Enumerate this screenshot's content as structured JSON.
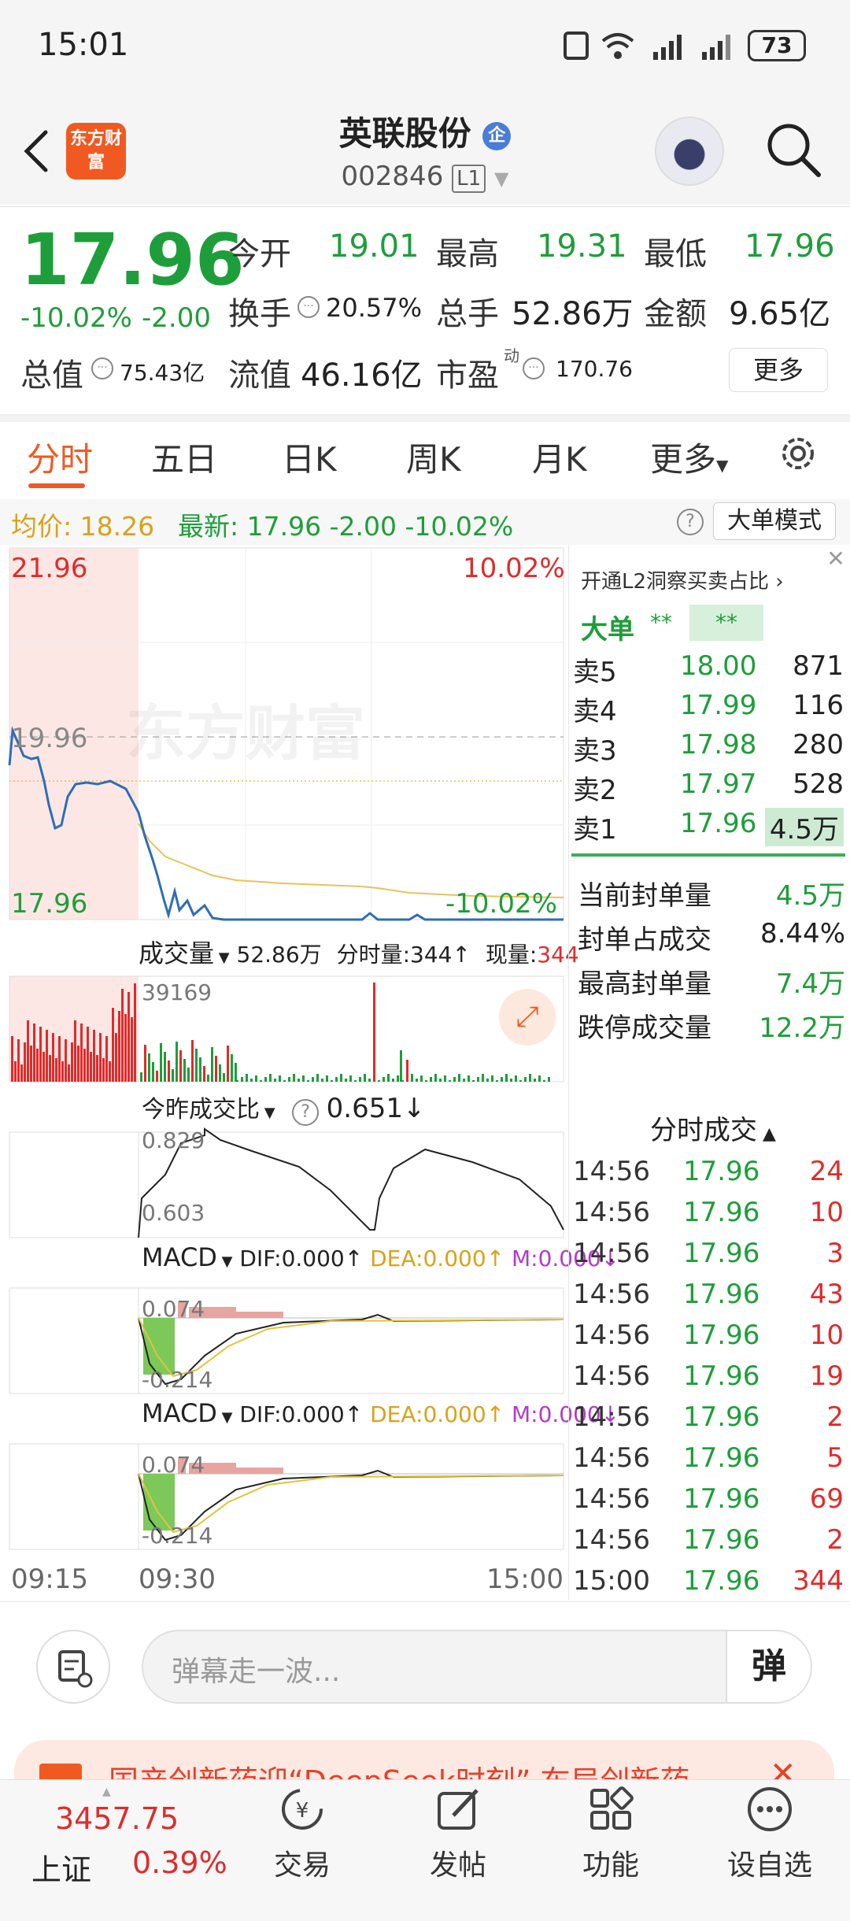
{
  "status_bar": {
    "time": "15:01",
    "battery": "73"
  },
  "header": {
    "logo_text": "东方财富",
    "stock_name": "英联股份",
    "stock_code": "002846",
    "level_badge": "L1"
  },
  "quote": {
    "price": "17.96",
    "change_pct": "-10.02%",
    "change": "-2.00",
    "open_label": "今开",
    "open": "19.01",
    "high_label": "最高",
    "high": "19.31",
    "low_label": "最低",
    "low": "17.96",
    "turnover_label": "换手",
    "turnover": "20.57%",
    "volume_label": "总手",
    "volume": "52.86万",
    "amount_label": "金额",
    "amount": "9.65亿",
    "mktcap_label": "总值",
    "mktcap": "75.43亿",
    "float_label": "流值",
    "float": "46.16亿",
    "pe_label": "市盈",
    "pe_sup": "动",
    "pe": "170.76",
    "more_button": "更多"
  },
  "tabs": [
    "分时",
    "五日",
    "日K",
    "周K",
    "月K",
    "更多"
  ],
  "info_bar": {
    "avg_label": "均价:",
    "avg": "18.26",
    "latest_label": "最新:",
    "latest": "17.96",
    "change": "-2.00",
    "change_pct": "-10.02%",
    "mode_button": "大单模式"
  },
  "chart": {
    "y_max": "21.96",
    "y_max_pct": "10.02%",
    "y_ref": "19.96",
    "y_min": "17.96",
    "y_min_pct": "-10.02%",
    "watermark": "东方财富",
    "volume_label": "成交量",
    "volume_total": "52.86万",
    "volume_minute": "分时量:344↑",
    "volume_now_label": "现量:",
    "volume_now": "344",
    "volume_max": "39169",
    "ratio_label": "今昨成交比",
    "ratio_value": "0.651↓",
    "ratio_max": "0.829",
    "ratio_min": "0.603",
    "macd_label": "MACD",
    "dif": "DIF:0.000↑",
    "dea": "DEA:0.000↑",
    "m": "M:0.000↓",
    "macd_max": "0.074",
    "macd_min": "-0.214",
    "x_start": "09:15",
    "x_mid": "09:30",
    "x_end": "15:00"
  },
  "chart_data": {
    "type": "line",
    "title": "",
    "x": [
      "09:15",
      "09:30",
      "15:00"
    ],
    "ylim": [
      17.96,
      21.96
    ],
    "series": [],
    "ref_price": 19.96
  },
  "side_panel": {
    "promo": "开通L2洞察买卖占比",
    "big_order_label": "大单",
    "asks": [
      {
        "label": "卖5",
        "price": "18.00",
        "vol": "871"
      },
      {
        "label": "卖4",
        "price": "17.99",
        "vol": "116"
      },
      {
        "label": "卖3",
        "price": "17.98",
        "vol": "280"
      },
      {
        "label": "卖2",
        "price": "17.97",
        "vol": "528"
      },
      {
        "label": "卖1",
        "price": "17.96",
        "vol": "4.5万"
      }
    ],
    "stats": [
      {
        "label": "当前封单量",
        "value": "4.5万"
      },
      {
        "label": "封单占成交",
        "value": "8.44%"
      },
      {
        "label": "最高封单量",
        "value": "7.4万"
      },
      {
        "label": "跌停成交量",
        "value": "12.2万"
      }
    ],
    "trades_title": "分时成交",
    "trades": [
      {
        "t": "14:56",
        "p": "17.96",
        "v": "24"
      },
      {
        "t": "14:56",
        "p": "17.96",
        "v": "10"
      },
      {
        "t": "14:56",
        "p": "17.96",
        "v": "3"
      },
      {
        "t": "14:56",
        "p": "17.96",
        "v": "43"
      },
      {
        "t": "14:56",
        "p": "17.96",
        "v": "10"
      },
      {
        "t": "14:56",
        "p": "17.96",
        "v": "19"
      },
      {
        "t": "14:56",
        "p": "17.96",
        "v": "2"
      },
      {
        "t": "14:56",
        "p": "17.96",
        "v": "5"
      },
      {
        "t": "14:56",
        "p": "17.96",
        "v": "69"
      },
      {
        "t": "14:56",
        "p": "17.96",
        "v": "2"
      },
      {
        "t": "15:00",
        "p": "17.96",
        "v": "344"
      }
    ]
  },
  "input_bar": {
    "placeholder": "弹幕走一波...",
    "danmu_button": "弹"
  },
  "banner": {
    "text": "国产创新药迎“DeepSeek时刻” 布局创新药"
  },
  "bottom_nav": {
    "index_value": "3457.75",
    "index_name": "上证",
    "index_change": "0.39%",
    "items": [
      "交易",
      "发帖",
      "功能",
      "设自选"
    ]
  }
}
